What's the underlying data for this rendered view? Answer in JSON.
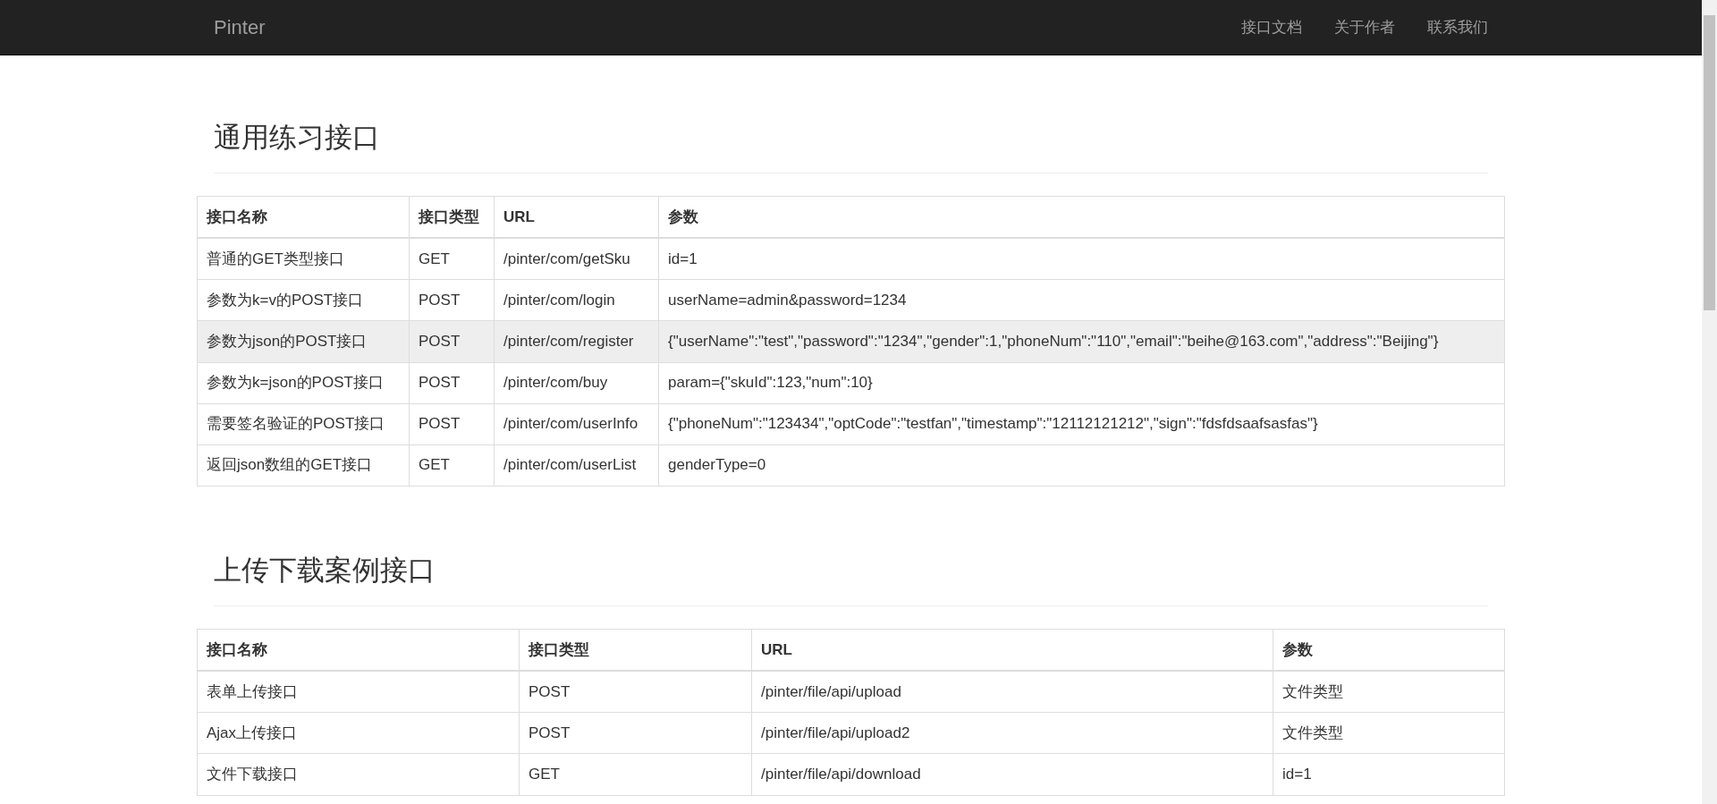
{
  "navbar": {
    "brand": "Pinter",
    "links": [
      "接口文档",
      "关于作者",
      "联系我们"
    ]
  },
  "sections": [
    {
      "title": "通用练习接口",
      "columns": [
        "接口名称",
        "接口类型",
        "URL",
        "参数"
      ],
      "rows": [
        {
          "cells": [
            "普通的GET类型接口",
            "GET",
            "/pinter/com/getSku",
            "id=1"
          ],
          "highlighted": false
        },
        {
          "cells": [
            "参数为k=v的POST接口",
            "POST",
            "/pinter/com/login",
            "userName=admin&password=1234"
          ],
          "highlighted": false
        },
        {
          "cells": [
            "参数为json的POST接口",
            "POST",
            "/pinter/com/register",
            "{\"userName\":\"test\",\"password\":\"1234\",\"gender\":1,\"phoneNum\":\"110\",\"email\":\"beihe@163.com\",\"address\":\"Beijing\"}"
          ],
          "highlighted": true
        },
        {
          "cells": [
            "参数为k=json的POST接口",
            "POST",
            "/pinter/com/buy",
            "param={\"skuId\":123,\"num\":10}"
          ],
          "highlighted": false
        },
        {
          "cells": [
            "需要签名验证的POST接口",
            "POST",
            "/pinter/com/userInfo",
            "{\"phoneNum\":\"123434\",\"optCode\":\"testfan\",\"timestamp\":\"12112121212\",\"sign\":\"fdsfdsaafsasfas\"}"
          ],
          "highlighted": false
        },
        {
          "cells": [
            "返回json数组的GET接口",
            "GET",
            "/pinter/com/userList",
            "genderType=0"
          ],
          "highlighted": false
        }
      ]
    },
    {
      "title": "上传下载案例接口",
      "columns": [
        "接口名称",
        "接口类型",
        "URL",
        "参数"
      ],
      "rows": [
        {
          "cells": [
            "表单上传接口",
            "POST",
            "/pinter/file/api/upload",
            "文件类型"
          ],
          "highlighted": false
        },
        {
          "cells": [
            "Ajax上传接口",
            "POST",
            "/pinter/file/api/upload2",
            "文件类型"
          ],
          "highlighted": false
        },
        {
          "cells": [
            "文件下载接口",
            "GET",
            "/pinter/file/api/download",
            "id=1"
          ],
          "highlighted": false
        }
      ]
    }
  ]
}
